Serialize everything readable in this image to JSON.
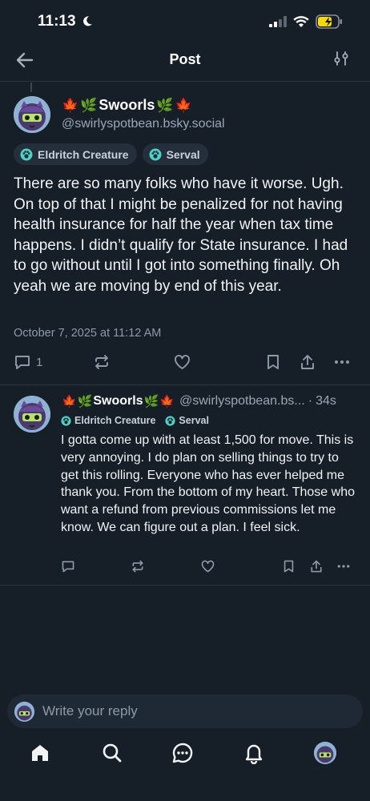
{
  "status_bar": {
    "time": "11:13"
  },
  "header": {
    "title": "Post"
  },
  "main_post": {
    "display_name": "Swoorls",
    "handle": "@swirlyspotbean.bsky.social",
    "badges": [
      "Eldritch Creature",
      "Serval"
    ],
    "text": "There are so many folks who have it worse. Ugh. On top of that I might be penalized for not having health insurance for half the year when tax time happens. I didn’t qualify for State insurance. I had to go without until I got into something finally. Oh yeah we are moving by end of this year.",
    "timestamp": "October 7, 2025 at 11:12 AM",
    "reply_count": "1"
  },
  "reply_post": {
    "display_name": "Swoorls",
    "handle": "@swirlyspotbean.bs...",
    "separator": "·",
    "time": "34s",
    "badges": [
      "Eldritch Creature",
      "Serval"
    ],
    "text": "I gotta come up with at least 1,500 for move. This is very annoying. I do plan on selling things to try to get this rolling. Everyone who has ever helped me thank you. From the bottom of my heart. Those who want a refund from previous commissions let me know. We can figure out a plan. I feel sick."
  },
  "composer": {
    "placeholder": "Write your reply"
  },
  "colors": {
    "background": "#161e27",
    "badge_icon": "#4fd1c5",
    "battery": "#f5d90a",
    "divider": "#2a3542"
  },
  "icons": [
    "back-arrow-icon",
    "settings-sliders-icon",
    "leaf-icon",
    "comment-icon",
    "repost-icon",
    "heart-icon",
    "bookmark-icon",
    "share-icon",
    "more-icon",
    "home-icon",
    "search-icon",
    "chat-icon",
    "bell-icon"
  ]
}
